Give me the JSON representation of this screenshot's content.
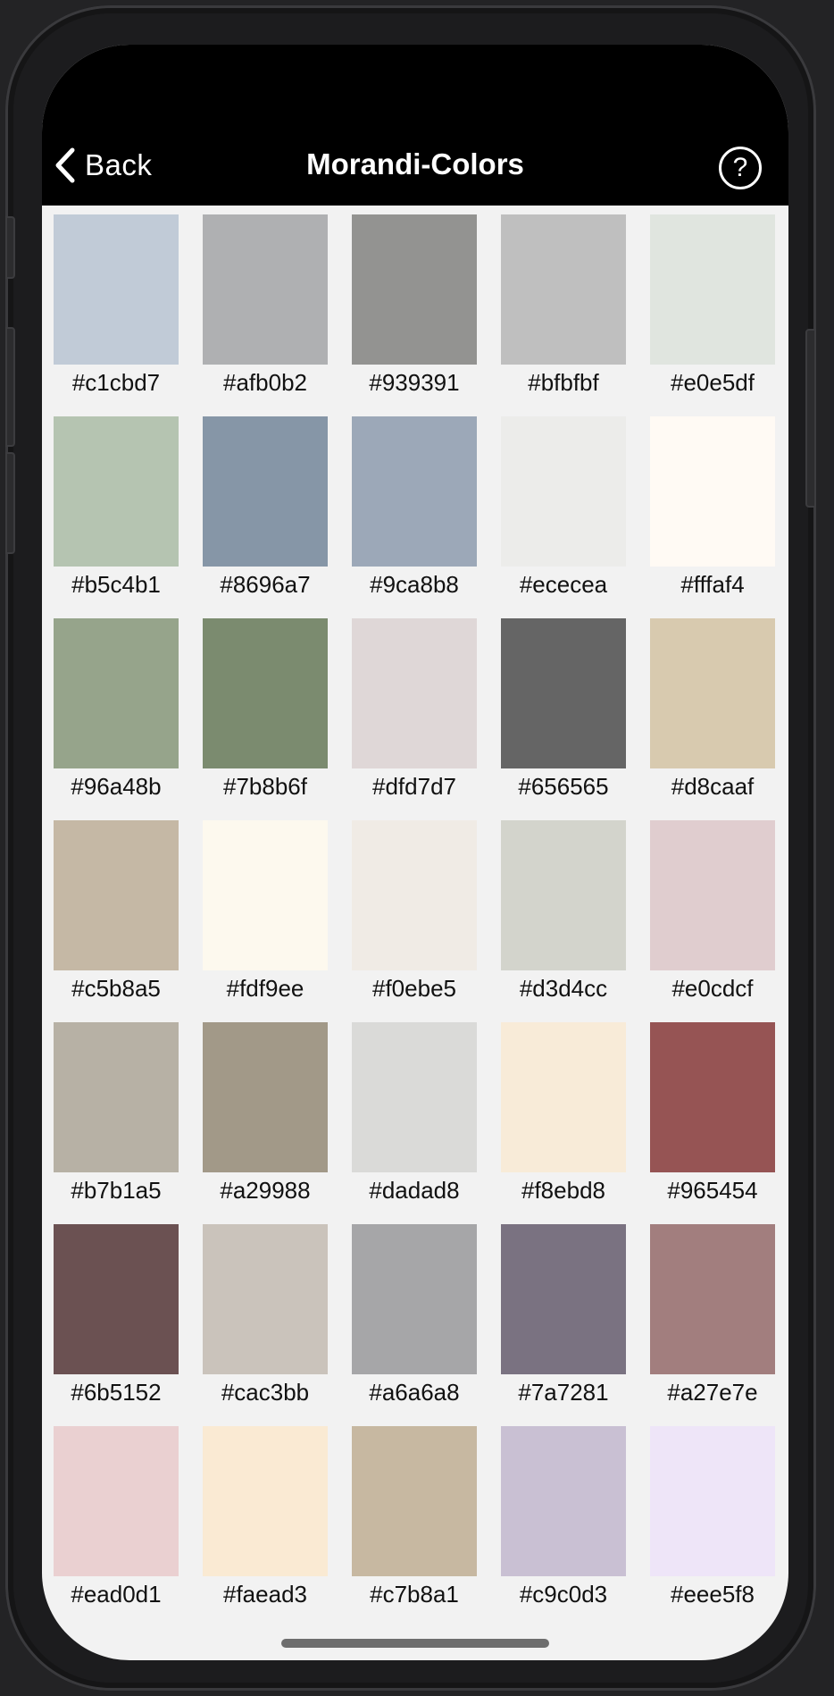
{
  "header": {
    "back_label": "Back",
    "title": "Morandi-Colors",
    "help_label": "?"
  },
  "colors": [
    "#c1cbd7",
    "#afb0b2",
    "#939391",
    "#bfbfbf",
    "#e0e5df",
    "#b5c4b1",
    "#8696a7",
    "#9ca8b8",
    "#ececea",
    "#fffaf4",
    "#96a48b",
    "#7b8b6f",
    "#dfd7d7",
    "#656565",
    "#d8caaf",
    "#c5b8a5",
    "#fdf9ee",
    "#f0ebe5",
    "#d3d4cc",
    "#e0cdcf",
    "#b7b1a5",
    "#a29988",
    "#dadad8",
    "#f8ebd8",
    "#965454",
    "#6b5152",
    "#cac3bb",
    "#a6a6a8",
    "#7a7281",
    "#a27e7e",
    "#ead0d1",
    "#faead3",
    "#c7b8a1",
    "#c9c0d3",
    "#eee5f8"
  ]
}
